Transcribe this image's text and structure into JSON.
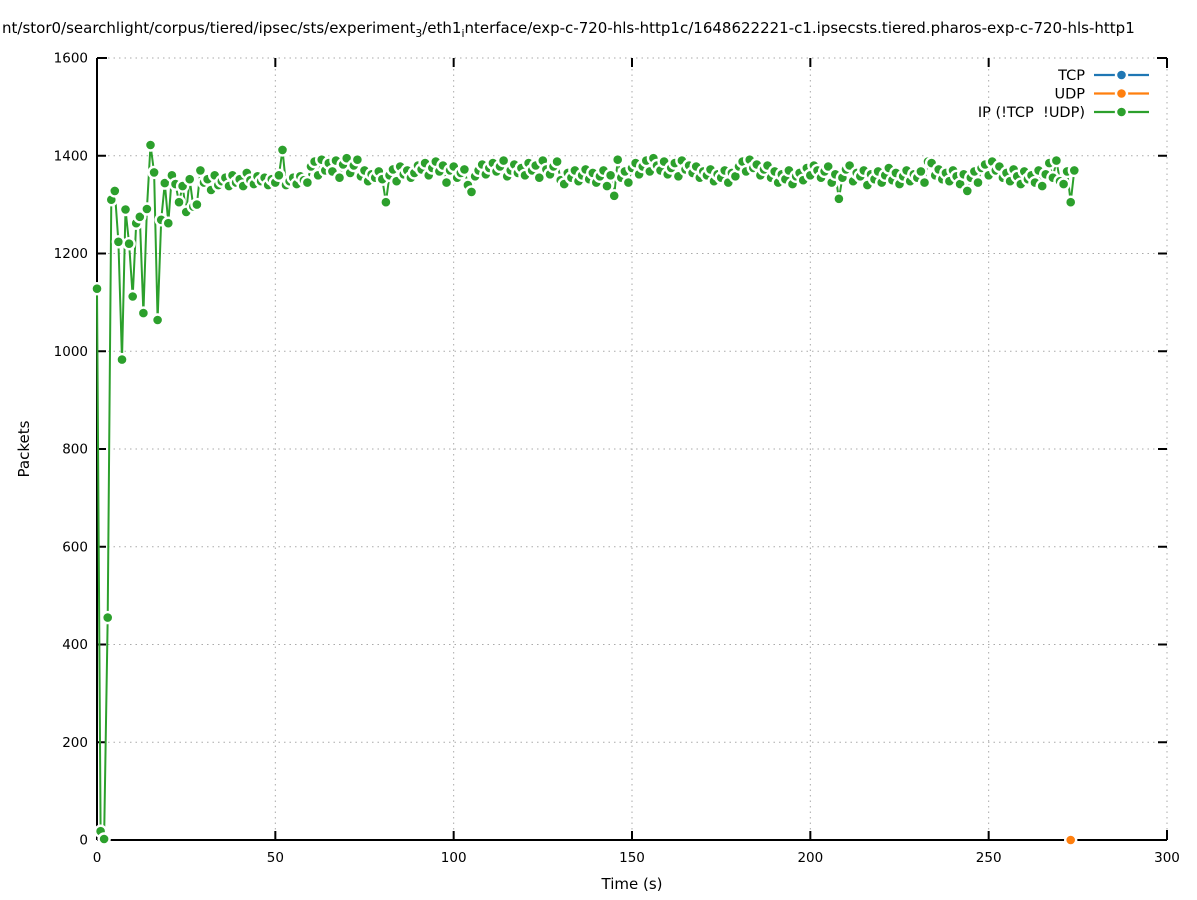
{
  "title_segments": {
    "seg1": "nt/stor0/searchlight/corpus/tiered/ipsec/sts/experiment",
    "sub1": "3",
    "seg2": "/eth1",
    "sub2": "i",
    "seg3": "nterface/exp-c-720-hls-http1c/1648622221-c1.ipsecsts.tiered.pharos-exp-c-720-hls-http1"
  },
  "axis": {
    "x_label": "Time (s)",
    "y_label": "Packets"
  },
  "chart_data": {
    "type": "line",
    "title": "nt/stor0/searchlight/corpus/tiered/ipsec/sts/experiment_3/eth1_interface/exp-c-720-hls-http1c/1648622221-c1.ipsecsts.tiered.pharos-exp-c-720-hls-http1",
    "xlabel": "Time (s)",
    "ylabel": "Packets",
    "xlim": [
      0,
      300
    ],
    "ylim": [
      0,
      1600
    ],
    "xticks": [
      0,
      50,
      100,
      150,
      200,
      250,
      300
    ],
    "yticks": [
      0,
      200,
      400,
      600,
      800,
      1000,
      1200,
      1400,
      1600
    ],
    "grid": "dotted both axes",
    "legend_position": "inside top-right",
    "marker_style": "filled circle with white edge",
    "colors": {
      "tcp": "#1f77b4",
      "udp": "#ff7f0e",
      "ip_other": "#2ca02c",
      "grid": "#aaaaaa",
      "axis": "#000000"
    },
    "series": [
      {
        "name": "TCP",
        "color": "#1f77b4",
        "points": []
      },
      {
        "name": "UDP",
        "color": "#ff7f0e",
        "points": [
          [
            273,
            0
          ]
        ]
      },
      {
        "name": "IP (!TCP  !UDP)",
        "color": "#2ca02c",
        "x_start": 0,
        "dx": 1,
        "values": [
          1128,
          18,
          2,
          455,
          1310,
          1328,
          1224,
          983,
          1290,
          1220,
          1112,
          1262,
          1275,
          1078,
          1291,
          1422,
          1366,
          1064,
          1269,
          1344,
          1262,
          1360,
          1342,
          1305,
          1338,
          1285,
          1352,
          1296,
          1300,
          1370,
          1345,
          1352,
          1330,
          1360,
          1340,
          1348,
          1355,
          1338,
          1360,
          1345,
          1352,
          1338,
          1365,
          1350,
          1342,
          1358,
          1348,
          1355,
          1340,
          1352,
          1345,
          1360,
          1412,
          1340,
          1348,
          1355,
          1342,
          1358,
          1350,
          1345,
          1378,
          1388,
          1360,
          1392,
          1370,
          1385,
          1368,
          1390,
          1355,
          1382,
          1395,
          1365,
          1380,
          1392,
          1358,
          1370,
          1348,
          1362,
          1355,
          1368,
          1352,
          1305,
          1360,
          1372,
          1348,
          1378,
          1362,
          1370,
          1355,
          1365,
          1380,
          1372,
          1385,
          1360,
          1375,
          1388,
          1368,
          1380,
          1345,
          1370,
          1378,
          1355,
          1365,
          1372,
          1340,
          1326,
          1358,
          1370,
          1382,
          1362,
          1375,
          1385,
          1368,
          1378,
          1390,
          1358,
          1370,
          1382,
          1365,
          1375,
          1360,
          1385,
          1370,
          1380,
          1355,
          1390,
          1372,
          1362,
          1378,
          1388,
          1350,
          1342,
          1365,
          1355,
          1370,
          1348,
          1360,
          1372,
          1352,
          1365,
          1345,
          1358,
          1370,
          1338,
          1360,
          1318,
          1392,
          1355,
          1368,
          1345,
          1375,
          1385,
          1362,
          1378,
          1390,
          1368,
          1395,
          1380,
          1370,
          1388,
          1362,
          1375,
          1385,
          1358,
          1390,
          1372,
          1380,
          1365,
          1378,
          1355,
          1368,
          1360,
          1372,
          1348,
          1362,
          1355,
          1370,
          1345,
          1365,
          1358,
          1378,
          1388,
          1368,
          1392,
          1375,
          1382,
          1360,
          1372,
          1380,
          1355,
          1368,
          1345,
          1362,
          1352,
          1370,
          1342,
          1358,
          1365,
          1350,
          1375,
          1360,
          1380,
          1370,
          1355,
          1368,
          1378,
          1345,
          1362,
          1312,
          1355,
          1372,
          1380,
          1348,
          1365,
          1358,
          1370,
          1340,
          1362,
          1352,
          1368,
          1345,
          1360,
          1375,
          1350,
          1365,
          1342,
          1358,
          1370,
          1348,
          1362,
          1355,
          1368,
          1345,
          1388,
          1385,
          1360,
          1372,
          1352,
          1365,
          1348,
          1370,
          1358,
          1342,
          1362,
          1328,
          1355,
          1368,
          1345,
          1375,
          1382,
          1360,
          1388,
          1370,
          1378,
          1355,
          1365,
          1348,
          1372,
          1358,
          1342,
          1368,
          1352,
          1360,
          1345,
          1370,
          1338,
          1362,
          1385,
          1355,
          1390,
          1348,
          1342,
          1368,
          1305,
          1370
        ]
      }
    ]
  }
}
